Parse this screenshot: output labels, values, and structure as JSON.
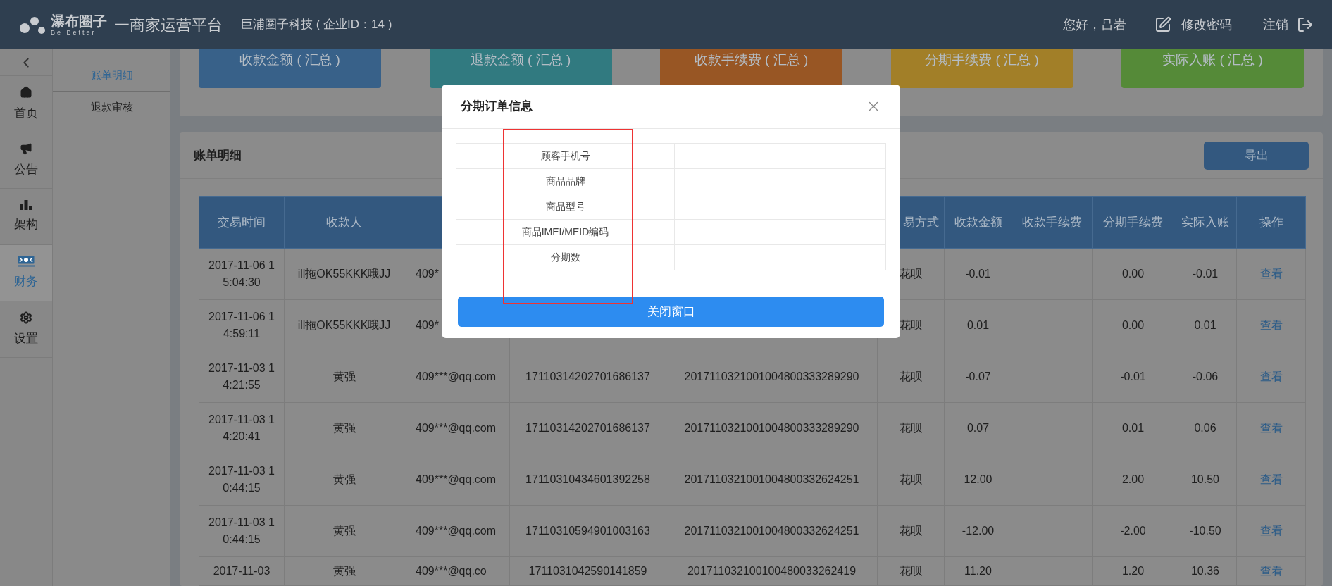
{
  "header": {
    "logo_text": "瀑布圈子",
    "logo_subtitle": "Be Better",
    "platform_title": "一商家运营平台",
    "company": "巨浦圈子科技 ( 企业ID：14 )",
    "greeting": "您好，吕岩",
    "change_password": "修改密码",
    "logout": "注销"
  },
  "nav": {
    "items": [
      {
        "label": "首页",
        "kind": "home",
        "selected": false
      },
      {
        "label": "公告",
        "kind": "megaphone",
        "selected": false
      },
      {
        "label": "架构",
        "kind": "chart",
        "selected": false
      },
      {
        "label": "财务",
        "kind": "money",
        "selected": true
      },
      {
        "label": "设置",
        "kind": "gear",
        "selected": false
      }
    ]
  },
  "submenu": {
    "items": [
      {
        "label": "账单明细",
        "selected": true
      },
      {
        "label": "退款审核",
        "selected": false
      }
    ]
  },
  "summary_cards": [
    {
      "label": "收款金额 ( 汇总 )",
      "color": "#386189"
    },
    {
      "label": "退款金额 ( 汇总 )",
      "color": "#317a80"
    },
    {
      "label": "收款手续费 ( 汇总 )",
      "color": "#985624"
    },
    {
      "label": "分期手续费 ( 汇总 )",
      "color": "#a27f28"
    },
    {
      "label": "实际入账 ( 汇总 )",
      "color": "#558a38"
    }
  ],
  "bill_panel": {
    "title": "账单明细",
    "export_button": "导出",
    "table": {
      "columns": [
        {
          "label": "交易时间"
        },
        {
          "label": "收款人"
        },
        {},
        {},
        {},
        {
          "label": "易方式"
        },
        {
          "label": "收款金额"
        },
        {
          "label": "收款手续费"
        },
        {
          "label": "分期手续费"
        },
        {
          "label": "实际入账"
        },
        {
          "label": "操作"
        }
      ],
      "rows": [
        {
          "cells": [
            "2017-11-06 15:04:30",
            "ill拖OK55KKK哦JJ",
            "409*",
            null,
            null,
            "花呗",
            "-0.01",
            null,
            "0.00",
            "-0.01"
          ],
          "action": "查看"
        },
        {
          "cells": [
            "2017-11-06 14:59:11",
            "ill拖OK55KKK哦JJ",
            "409*",
            null,
            null,
            "花呗",
            "0.01",
            null,
            "0.00",
            "0.01"
          ],
          "action": "查看"
        },
        {
          "cells": [
            "2017-11-03 14:21:55",
            "黄强",
            "409***@qq.com",
            "17110314202701686137",
            "2017110321001004800333289290",
            "花呗",
            "-0.07",
            null,
            "-0.01",
            "-0.06"
          ],
          "action": "查看"
        },
        {
          "cells": [
            "2017-11-03 14:20:41",
            "黄强",
            "409***@qq.com",
            "17110314202701686137",
            "2017110321001004800333289290",
            "花呗",
            "0.07",
            null,
            "0.01",
            "0.06"
          ],
          "action": "查看"
        },
        {
          "cells": [
            "2017-11-03 10:44:15",
            "黄强",
            "409***@qq.com",
            "17110310434601392258",
            "2017110321001004800332624251",
            "花呗",
            "12.00",
            null,
            "2.00",
            "10.50"
          ],
          "action": "查看"
        },
        {
          "cells": [
            "2017-11-03 10:44:15",
            "黄强",
            "409***@qq.com",
            "17110310594901003163",
            "2017110321001004800332624251",
            "花呗",
            "-12.00",
            null,
            "-2.00",
            "-10.50"
          ],
          "action": "查看"
        },
        {
          "cells": [
            "2017-11-03",
            "黄强",
            "409***@qq.co",
            "1711031042590141859",
            "201711032100100480033262419",
            "花呗",
            "11.20",
            null,
            "1.20",
            "10.36"
          ],
          "action": "查看"
        }
      ]
    }
  },
  "modal": {
    "title": "分期订单信息",
    "rows": [
      {
        "label": "顾客手机号"
      },
      {
        "label": "商品品牌"
      },
      {
        "label": "商品型号"
      },
      {
        "label": "商品IMEI/MEID编码"
      },
      {
        "label": "分期数"
      }
    ],
    "close_button": "关闭窗口"
  }
}
